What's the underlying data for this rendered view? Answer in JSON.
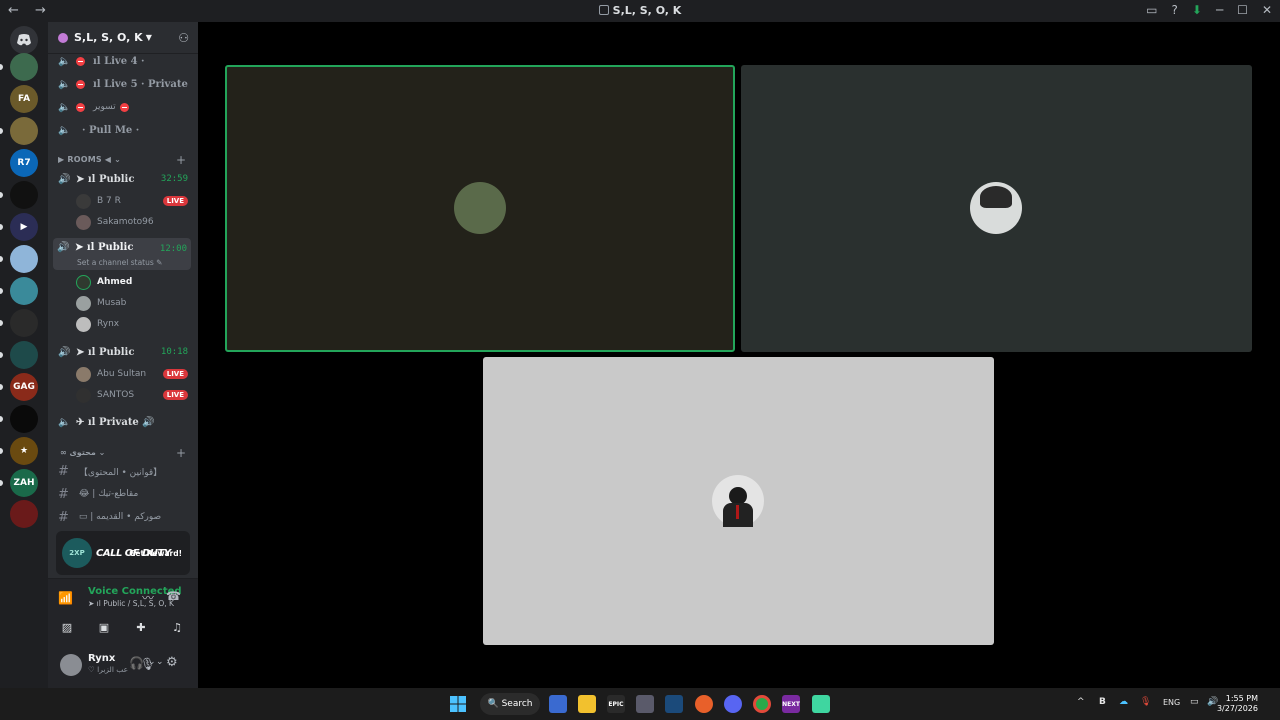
{
  "window": {
    "title": "S,L, S, O, K",
    "nav_glyphs": "← →",
    "controls": {
      "minimize": "─",
      "maximize": "☐",
      "close": "✕",
      "inbox": "▭",
      "help": "?",
      "download": "⬇"
    }
  },
  "server_rail": {
    "servers": [
      {
        "label": "",
        "color": "#3d6a4e"
      },
      {
        "label": "FA",
        "color": "#6b5a2a"
      },
      {
        "label": "",
        "color": "#7a6a3a"
      },
      {
        "label": "R7",
        "color": "#0b67b7"
      },
      {
        "label": "",
        "color": "#111111"
      },
      {
        "label": "▶",
        "color": "#2b2d55"
      },
      {
        "label": "",
        "color": "#8fb5d9"
      },
      {
        "label": "",
        "color": "#3a8a9a"
      },
      {
        "label": "",
        "color": "#2a2a2a"
      },
      {
        "label": "",
        "color": "#1e4a4a"
      },
      {
        "label": "GAG",
        "color": "#8a2a1a"
      },
      {
        "label": "",
        "color": "#0a0a0a"
      },
      {
        "label": "★",
        "color": "#6a4a10"
      },
      {
        "label": "ZAH",
        "color": "#1a6a4a"
      },
      {
        "label": "",
        "color": "#6a1a1a"
      }
    ]
  },
  "guild": {
    "name": "S,L, S, O, K"
  },
  "channels": {
    "top": [
      {
        "label": "ıl Live 4 ·"
      },
      {
        "label": "ıl Live 5 · Private"
      },
      {
        "label": "تسوير"
      },
      {
        "label": "· Pull Me ·"
      }
    ],
    "rooms_category": "▶ ROOMS ◀",
    "public1": {
      "label": "➤ ıl Public",
      "time": "32:59",
      "users": [
        {
          "name": "B 7 R",
          "live": "LIVE"
        },
        {
          "name": "Sakamoto96"
        }
      ]
    },
    "public2": {
      "label": "➤ ıl Public",
      "time": "12:00",
      "status": "Set a channel status ✎",
      "users": [
        {
          "name": "Ahmed"
        },
        {
          "name": "Musab"
        },
        {
          "name": "Rynx"
        }
      ]
    },
    "public3": {
      "label": "➤ ıl Public",
      "time": "10:18",
      "users": [
        {
          "name": "Abu Sultan",
          "live": "LIVE"
        },
        {
          "name": "SANTOS",
          "live": "LIVE"
        }
      ]
    },
    "private": {
      "label": "✈ ıl Private 🔊"
    },
    "content_category": "محتوى",
    "text_channels": [
      {
        "label": "【قوانين • المحتوى】"
      },
      {
        "label": "😂 | مقاطع-تيك"
      },
      {
        "label": "▭ | صوركم • القديمه"
      }
    ]
  },
  "promo": {
    "badge": "2XP",
    "title": "CALL OF DUTY",
    "cta": "Get Reward!"
  },
  "voice": {
    "status": "Voice Connected",
    "channel": "➤ ıl Public / S,L, S, O, K"
  },
  "user": {
    "name": "Rynx",
    "status": "♡ عب الزبرا"
  },
  "stage": {
    "tiles": [
      {
        "name": "tile-1",
        "avatar_color": "#5a6a4a",
        "speaking": true
      },
      {
        "name": "tile-2",
        "avatar_color": "#d9dcdb",
        "speaking": false
      },
      {
        "name": "tile-3",
        "avatar_color": "#2a2a35",
        "speaking": false
      }
    ]
  },
  "taskbar": {
    "search": "🔍 Search",
    "apps": [
      "",
      "",
      "",
      "EPIC",
      "",
      "",
      "",
      "",
      "",
      "NEXT",
      ""
    ],
    "tray": {
      "lang": "ENG",
      "chevron": "^"
    },
    "clock": {
      "time": "1:55 PM",
      "date": "3/27/2026"
    }
  }
}
